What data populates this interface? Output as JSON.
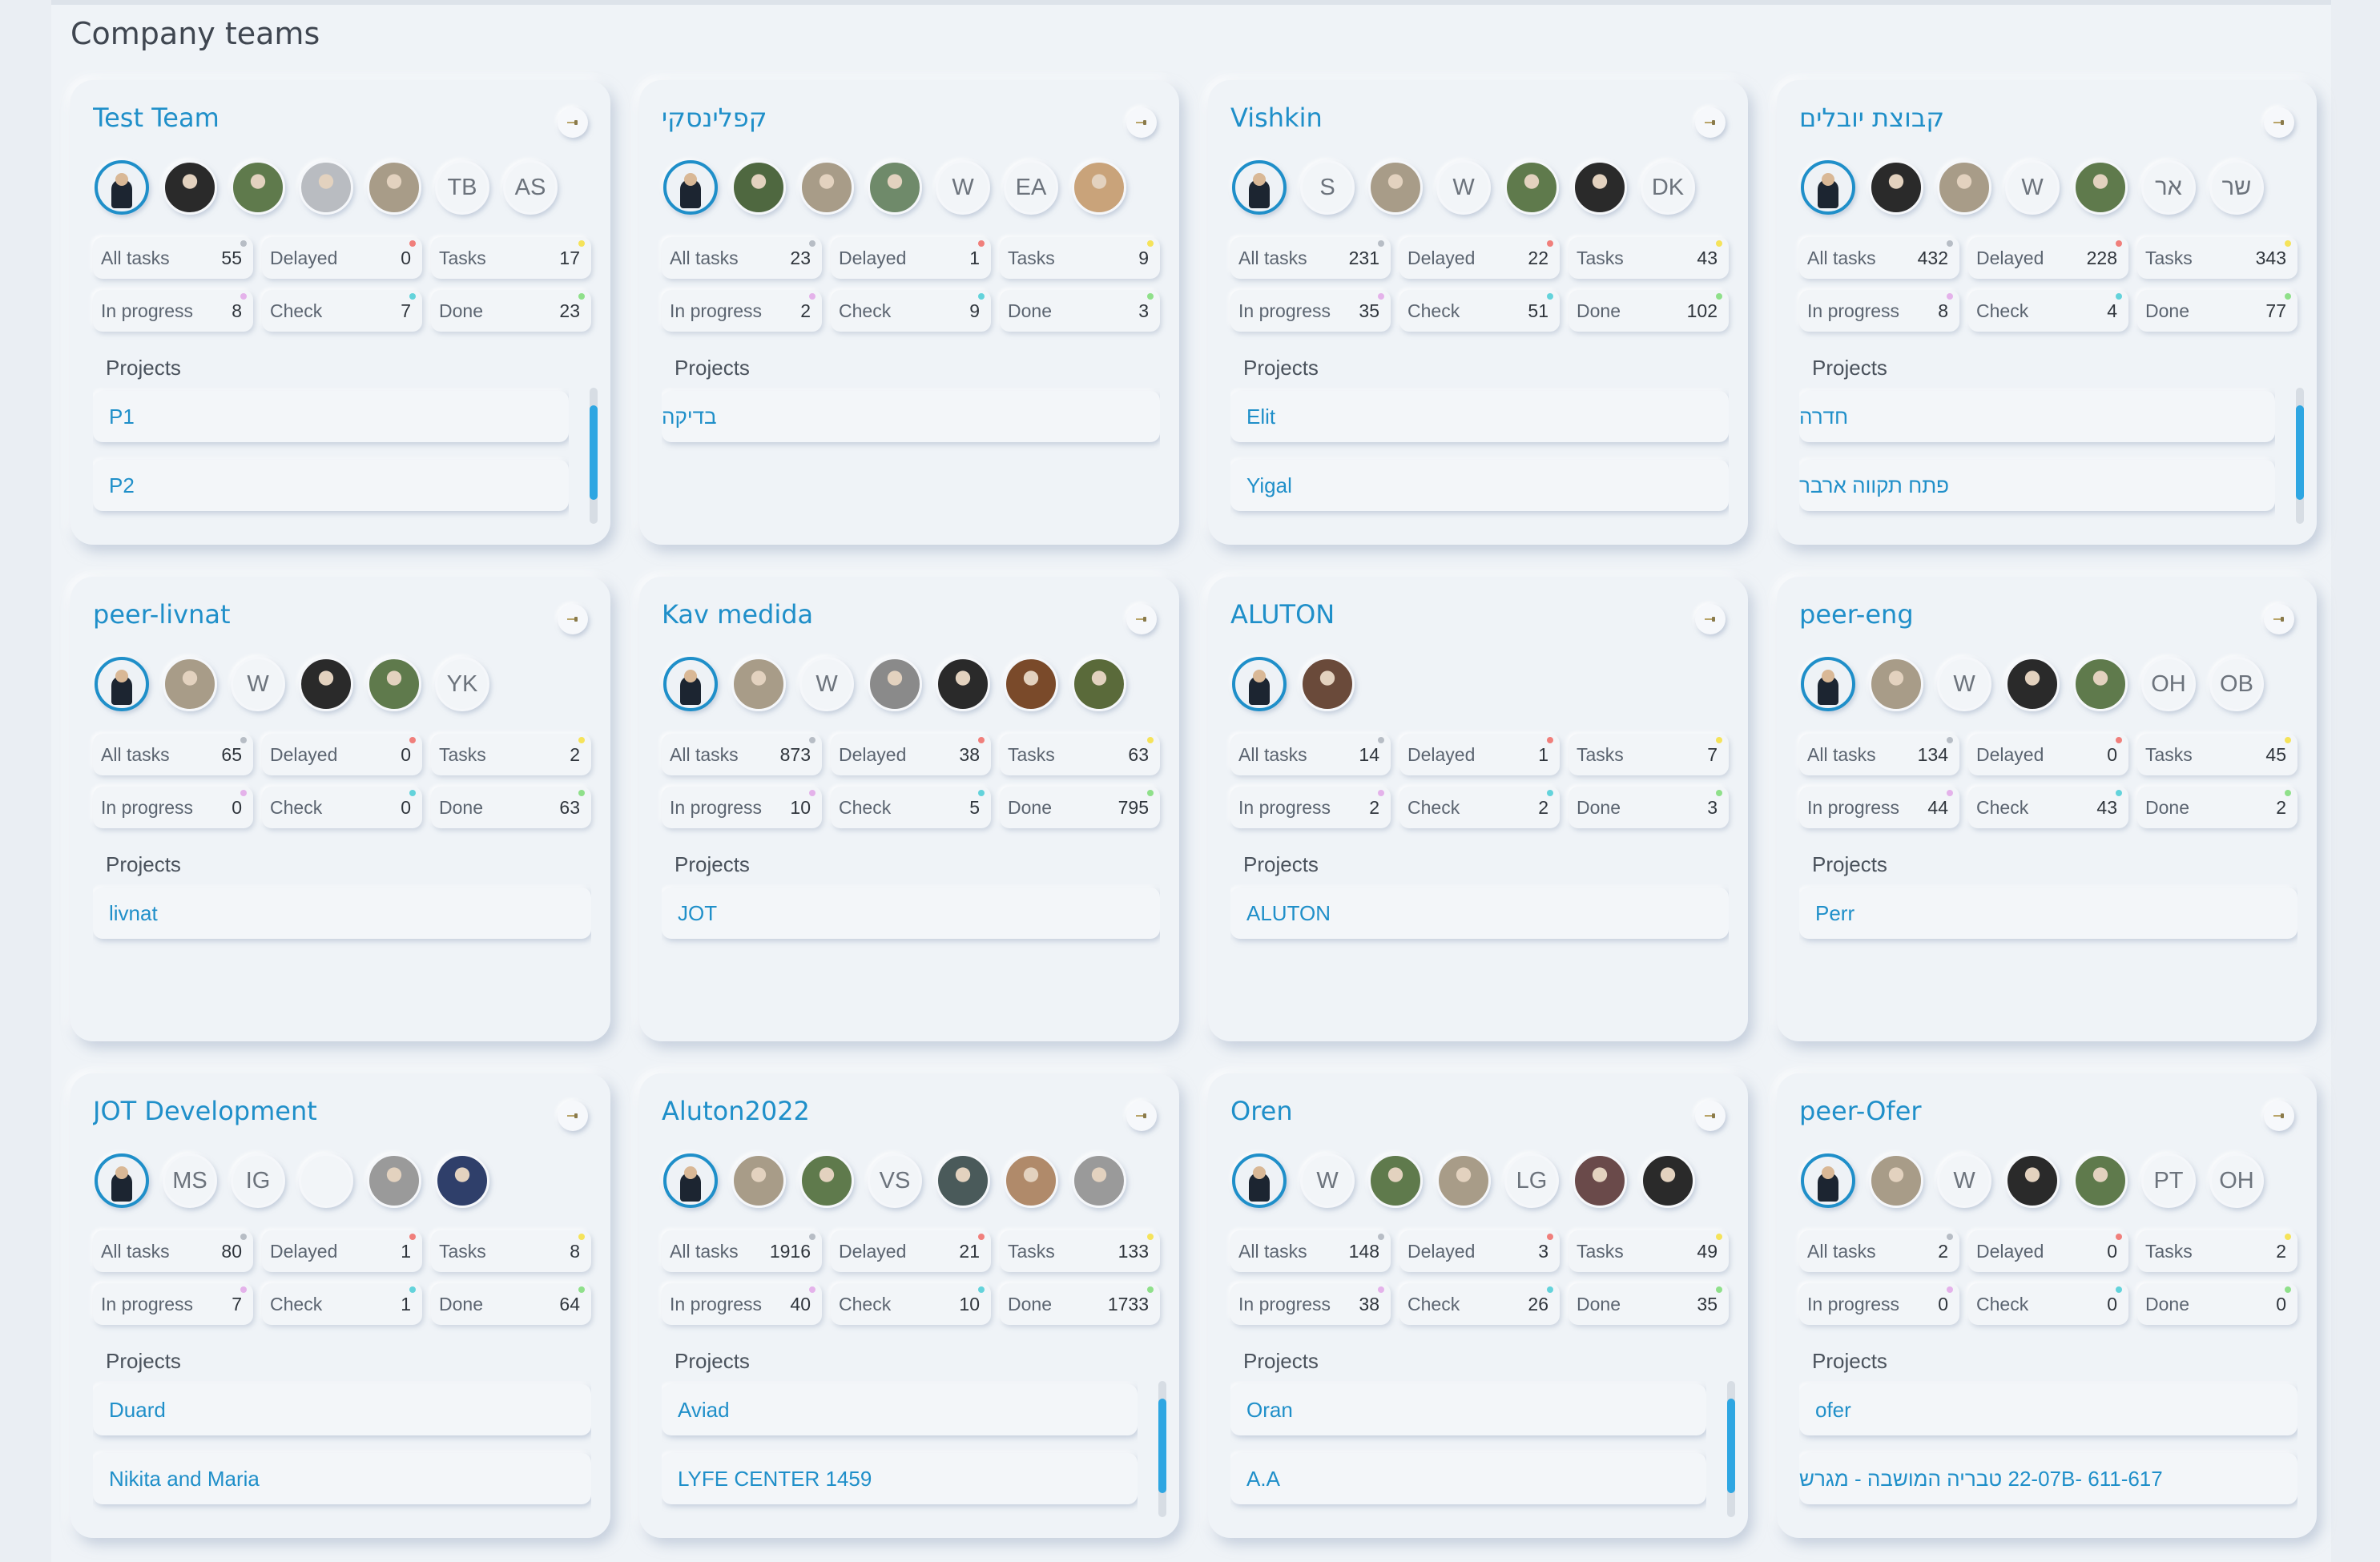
{
  "page": {
    "title": "Company teams"
  },
  "colors": {
    "accent": "#1f8fc9",
    "dot_all": "#b7bdc5",
    "dot_delayed": "#f07f7b",
    "dot_tasks": "#f5e35a",
    "dot_inprogress": "#e4b2ea",
    "dot_check": "#63d3db",
    "dot_done": "#8fe08a"
  },
  "labels": {
    "all_tasks": "All tasks",
    "delayed": "Delayed",
    "tasks": "Tasks",
    "in_progress": "In progress",
    "check": "Check",
    "done": "Done",
    "projects": "Projects"
  },
  "teams": [
    {
      "name": "Test Team",
      "members": [
        {
          "type": "photo",
          "selected": true
        },
        {
          "type": "photo",
          "tone": "#2a2a2a"
        },
        {
          "type": "photo",
          "tone": "#5f7a4c"
        },
        {
          "type": "photo",
          "tone": "#b9bcc1"
        },
        {
          "type": "photo",
          "tone": "#a89c88"
        },
        {
          "type": "initials",
          "initials": "TB"
        },
        {
          "type": "initials",
          "initials": "AS"
        }
      ],
      "stats": {
        "all_tasks": "55",
        "delayed": "0",
        "tasks": "17",
        "in_progress": "8",
        "check": "7",
        "done": "23"
      },
      "projects": [
        "P1",
        "P2"
      ],
      "scrollable": true
    },
    {
      "name": "קפלינסקי",
      "members": [
        {
          "type": "photo",
          "selected": true
        },
        {
          "type": "photo",
          "tone": "#4f6840"
        },
        {
          "type": "photo",
          "tone": "#a89c88"
        },
        {
          "type": "photo",
          "tone": "#6f8a6a"
        },
        {
          "type": "initials",
          "initials": "W"
        },
        {
          "type": "initials",
          "initials": "EA"
        },
        {
          "type": "photo",
          "tone": "#c9a37a"
        }
      ],
      "stats": {
        "all_tasks": "23",
        "delayed": "1",
        "tasks": "9",
        "in_progress": "2",
        "check": "9",
        "done": "3"
      },
      "projects": [
        "בדיקה"
      ],
      "scrollable": false
    },
    {
      "name": "Vishkin",
      "members": [
        {
          "type": "photo",
          "selected": true
        },
        {
          "type": "initials",
          "initials": "S"
        },
        {
          "type": "photo",
          "tone": "#a89c88"
        },
        {
          "type": "initials",
          "initials": "W"
        },
        {
          "type": "photo",
          "tone": "#5f7a4c"
        },
        {
          "type": "photo",
          "tone": "#2a2a2a"
        },
        {
          "type": "initials",
          "initials": "DK"
        }
      ],
      "stats": {
        "all_tasks": "231",
        "delayed": "22",
        "tasks": "43",
        "in_progress": "35",
        "check": "51",
        "done": "102"
      },
      "projects": [
        "Elit",
        "Yigal"
      ],
      "scrollable": false
    },
    {
      "name": "קבוצת יובלים",
      "members": [
        {
          "type": "photo",
          "selected": true
        },
        {
          "type": "photo",
          "tone": "#2a2a2a"
        },
        {
          "type": "photo",
          "tone": "#a89c88"
        },
        {
          "type": "initials",
          "initials": "W"
        },
        {
          "type": "photo",
          "tone": "#5f7a4c"
        },
        {
          "type": "initials",
          "initials": "אר"
        },
        {
          "type": "initials",
          "initials": "שר"
        }
      ],
      "stats": {
        "all_tasks": "432",
        "delayed": "228",
        "tasks": "343",
        "in_progress": "8",
        "check": "4",
        "done": "77"
      },
      "projects": [
        "חדרה",
        "פתח תקווה ארבר"
      ],
      "scrollable": true
    },
    {
      "name": "peer-livnat",
      "members": [
        {
          "type": "photo",
          "selected": true
        },
        {
          "type": "photo",
          "tone": "#a89c88"
        },
        {
          "type": "initials",
          "initials": "W"
        },
        {
          "type": "photo",
          "tone": "#2a2a2a"
        },
        {
          "type": "photo",
          "tone": "#5f7a4c"
        },
        {
          "type": "initials",
          "initials": "YK"
        }
      ],
      "stats": {
        "all_tasks": "65",
        "delayed": "0",
        "tasks": "2",
        "in_progress": "0",
        "check": "0",
        "done": "63"
      },
      "projects": [
        "livnat"
      ],
      "scrollable": false
    },
    {
      "name": "Kav medida",
      "members": [
        {
          "type": "photo",
          "selected": true
        },
        {
          "type": "photo",
          "tone": "#a89c88"
        },
        {
          "type": "initials",
          "initials": "W"
        },
        {
          "type": "photo",
          "tone": "#8a8a8a"
        },
        {
          "type": "photo",
          "tone": "#2a2a2a"
        },
        {
          "type": "photo",
          "tone": "#7a4a2a"
        },
        {
          "type": "photo",
          "tone": "#5a6a3a"
        }
      ],
      "stats": {
        "all_tasks": "873",
        "delayed": "38",
        "tasks": "63",
        "in_progress": "10",
        "check": "5",
        "done": "795"
      },
      "projects": [
        "JOT"
      ],
      "scrollable": false
    },
    {
      "name": "ALUTON",
      "members": [
        {
          "type": "photo",
          "selected": true
        },
        {
          "type": "photo",
          "tone": "#6a4a3a"
        }
      ],
      "stats": {
        "all_tasks": "14",
        "delayed": "1",
        "tasks": "7",
        "in_progress": "2",
        "check": "2",
        "done": "3"
      },
      "projects": [
        "ALUTON"
      ],
      "scrollable": false
    },
    {
      "name": "peer-eng",
      "members": [
        {
          "type": "photo",
          "selected": true
        },
        {
          "type": "photo",
          "tone": "#a89c88"
        },
        {
          "type": "initials",
          "initials": "W"
        },
        {
          "type": "photo",
          "tone": "#2a2a2a"
        },
        {
          "type": "photo",
          "tone": "#5f7a4c"
        },
        {
          "type": "initials",
          "initials": "OH"
        },
        {
          "type": "initials",
          "initials": "OB"
        }
      ],
      "stats": {
        "all_tasks": "134",
        "delayed": "0",
        "tasks": "45",
        "in_progress": "44",
        "check": "43",
        "done": "2"
      },
      "projects": [
        "Perr"
      ],
      "scrollable": false
    },
    {
      "name": "JOT Development",
      "members": [
        {
          "type": "photo",
          "selected": true
        },
        {
          "type": "initials",
          "initials": "MS"
        },
        {
          "type": "initials",
          "initials": "IG"
        },
        {
          "type": "initials",
          "initials": ""
        },
        {
          "type": "photo",
          "tone": "#9a9a9a"
        },
        {
          "type": "photo",
          "tone": "#2f3f6a"
        }
      ],
      "stats": {
        "all_tasks": "80",
        "delayed": "1",
        "tasks": "8",
        "in_progress": "7",
        "check": "1",
        "done": "64"
      },
      "projects": [
        "Duard",
        "Nikita and Maria"
      ],
      "scrollable": false
    },
    {
      "name": "Aluton2022",
      "members": [
        {
          "type": "photo",
          "selected": true
        },
        {
          "type": "photo",
          "tone": "#a89c88"
        },
        {
          "type": "photo",
          "tone": "#5f7a4c"
        },
        {
          "type": "initials",
          "initials": "VS"
        },
        {
          "type": "photo",
          "tone": "#4a5a5a"
        },
        {
          "type": "photo",
          "tone": "#b08a6a"
        },
        {
          "type": "photo",
          "tone": "#9a9a9a"
        }
      ],
      "stats": {
        "all_tasks": "1916",
        "delayed": "21",
        "tasks": "133",
        "in_progress": "40",
        "check": "10",
        "done": "1733"
      },
      "projects": [
        "Aviad",
        "LYFE CENTER 1459"
      ],
      "scrollable": true
    },
    {
      "name": "Oren",
      "members": [
        {
          "type": "photo",
          "selected": true
        },
        {
          "type": "initials",
          "initials": "W"
        },
        {
          "type": "photo",
          "tone": "#5f7a4c"
        },
        {
          "type": "photo",
          "tone": "#a89c88"
        },
        {
          "type": "initials",
          "initials": "LG"
        },
        {
          "type": "photo",
          "tone": "#6a4a4a"
        },
        {
          "type": "photo",
          "tone": "#2a2a2a"
        }
      ],
      "stats": {
        "all_tasks": "148",
        "delayed": "3",
        "tasks": "49",
        "in_progress": "38",
        "check": "26",
        "done": "35"
      },
      "projects": [
        "Oran",
        "A.A"
      ],
      "scrollable": true
    },
    {
      "name": "peer-Ofer",
      "members": [
        {
          "type": "photo",
          "selected": true
        },
        {
          "type": "photo",
          "tone": "#a89c88"
        },
        {
          "type": "initials",
          "initials": "W"
        },
        {
          "type": "photo",
          "tone": "#2a2a2a"
        },
        {
          "type": "photo",
          "tone": "#5f7a4c"
        },
        {
          "type": "initials",
          "initials": "PT"
        },
        {
          "type": "initials",
          "initials": "OH"
        }
      ],
      "stats": {
        "all_tasks": "2",
        "delayed": "0",
        "tasks": "2",
        "in_progress": "0",
        "check": "0",
        "done": "0"
      },
      "projects": [
        "ofer",
        "22-07B- 611-617 טבריה המושבה - מגרש"
      ],
      "scrollable": false
    }
  ]
}
